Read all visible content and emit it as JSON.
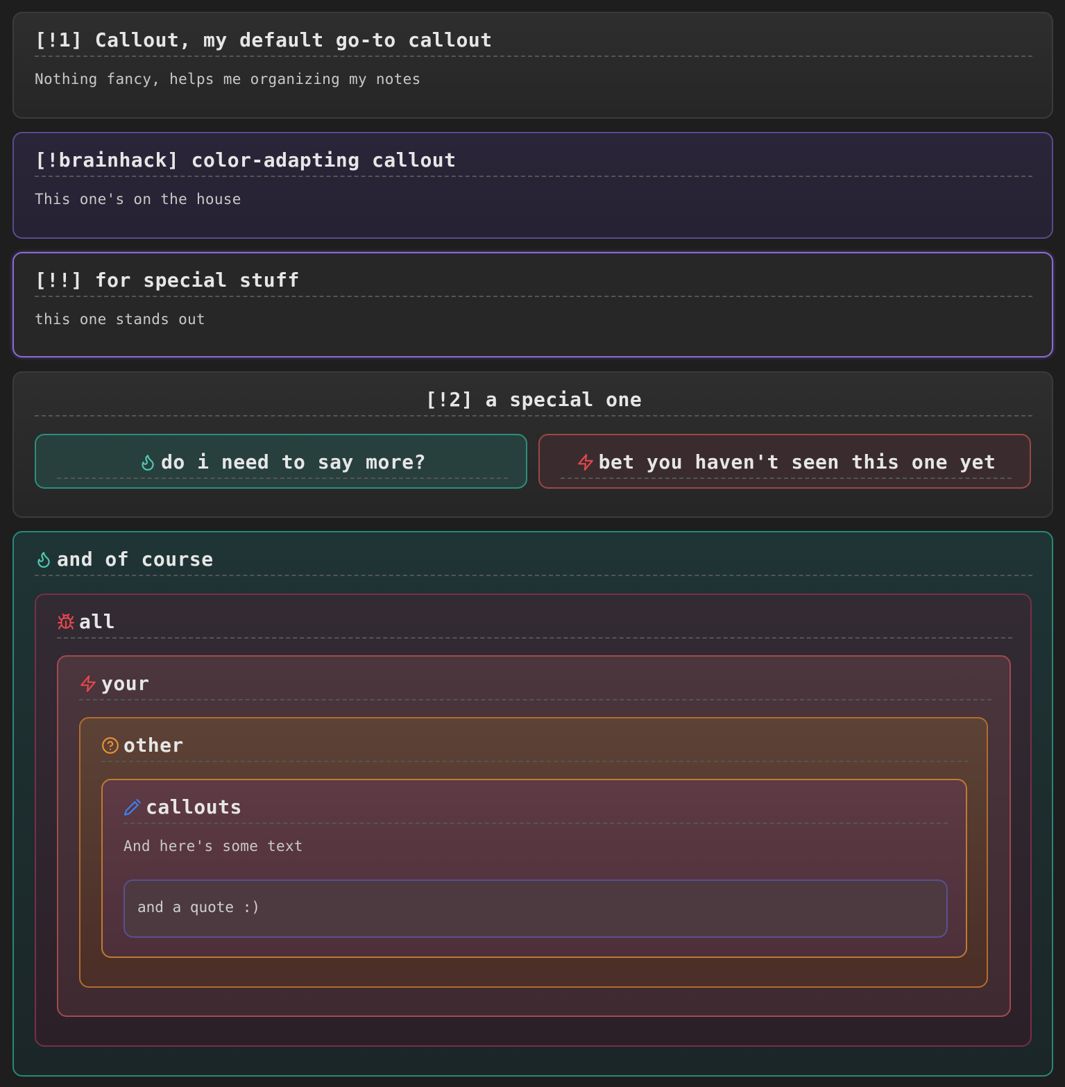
{
  "callouts": [
    {
      "title": "[!1] Callout, my default go-to callout",
      "body": "Nothing fancy, helps me organizing my notes"
    },
    {
      "title": "[!brainhack] color-adapting callout",
      "body": "This one's on the house"
    },
    {
      "title": "[!!] for special stuff",
      "body": "this one stands out"
    },
    {
      "title": "[!2] a special one"
    }
  ],
  "special_children": [
    {
      "title": "do i need to say more?",
      "icon": "flame-icon",
      "color": "#4ec9b0"
    },
    {
      "title": "bet you haven't seen this one yet",
      "icon": "zap-icon",
      "color": "#e5484d"
    }
  ],
  "nested": {
    "outer": {
      "title": "and of course",
      "icon": "flame-icon",
      "color": "#4ec9b0"
    },
    "level1": {
      "title": "all",
      "icon": "bug-icon",
      "color": "#e5484d"
    },
    "level2": {
      "title": "your",
      "icon": "zap-icon",
      "color": "#e5484d"
    },
    "level3": {
      "title": "other",
      "icon": "question-icon",
      "color": "#e8913a"
    },
    "level4": {
      "title": "callouts",
      "icon": "pencil-icon",
      "color": "#3b82f6",
      "body": "And here's some text",
      "quote": "and a quote :)"
    }
  },
  "colors": {
    "background": "#1e1e1e",
    "teal": "#2b8f7e",
    "red": "#9b4845",
    "orange": "#c07a30",
    "purple": "#8a6ad6"
  }
}
